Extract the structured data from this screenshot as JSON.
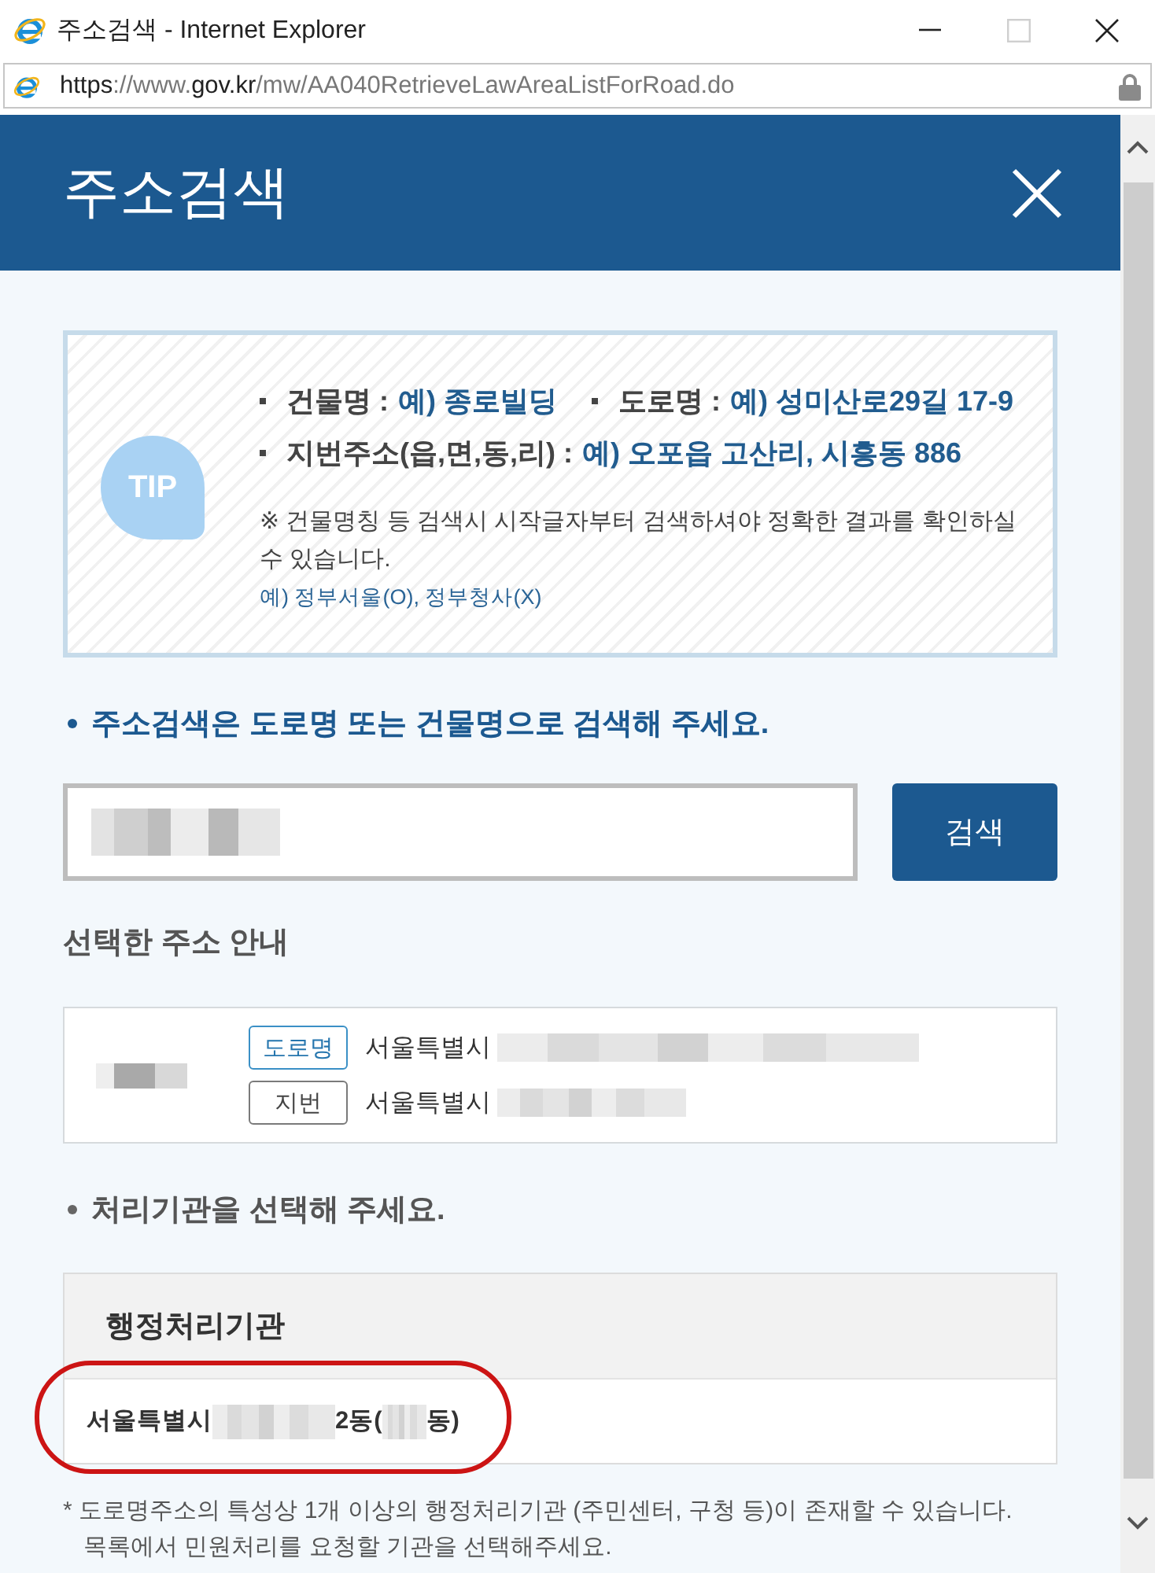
{
  "window": {
    "title": "주소검색 - Internet Explorer",
    "controls": [
      {
        "kind": "minimize",
        "disabled": false
      },
      {
        "kind": "maximize",
        "disabled": true
      },
      {
        "kind": "close",
        "disabled": false
      }
    ]
  },
  "address_bar": {
    "url": "**https**://www.**gov.kr**/mw/AA040RetrieveLawAreaListForRoad.do"
  },
  "dialog": {
    "title": "주소검색"
  },
  "tip": {
    "badge": "TIP",
    "example_rows": [
      [
        {
          "label": "건물명 :",
          "example": "예) 종로빌딩"
        },
        {
          "label": "도로명 :",
          "example": "예) 성미산로29길 17-9"
        }
      ],
      [
        {
          "label": "지번주소(읍,면,동,리) :",
          "example": "예) 오포읍 고산리, 시흥동 886"
        }
      ]
    ],
    "note": [
      "※ 건물명칭 등 검색시 시작글자부터 검색하셔야 정확한 결과를 확인하실",
      "수 있습니다."
    ],
    "note_example": "예) 정부서울(O), 정부청사(X)"
  },
  "search": {
    "instruction": "주소검색은 도로명 또는 건물명으로 검색해 주세요.",
    "value_redacted": true,
    "button": "검색"
  },
  "selected_address": {
    "heading": "선택한 주소 안내",
    "name_redacted": true,
    "lines": [
      {
        "kind": "road",
        "tag": "도로명",
        "segments": [
          {
            "kind": "text",
            "text": "서울특별시"
          },
          {
            "kind": "redacted"
          }
        ]
      },
      {
        "kind": "lot",
        "tag": "지번",
        "segments": [
          {
            "kind": "text",
            "text": "서울특별시"
          },
          {
            "kind": "redacted"
          }
        ]
      }
    ]
  },
  "agency": {
    "instruction": "처리기관을 선택해 주세요.",
    "columns": [
      "행정처리기관"
    ],
    "rows": [
      {
        "highlighted": true,
        "segments": [
          {
            "kind": "text",
            "text": "서울특별시"
          },
          {
            "kind": "redacted"
          },
          {
            "kind": "text",
            "text": "2동("
          },
          {
            "kind": "redacted"
          },
          {
            "kind": "text",
            "text": "동)"
          }
        ]
      }
    ],
    "footnote": [
      "* 도로명주소의 특성상 1개 이상의 행정처리기관 (주민센터, 구청 등)이 존재할 수 있습니다.",
      "목록에서 민원처리를 요청할 기관을 선택해주세요."
    ]
  }
}
